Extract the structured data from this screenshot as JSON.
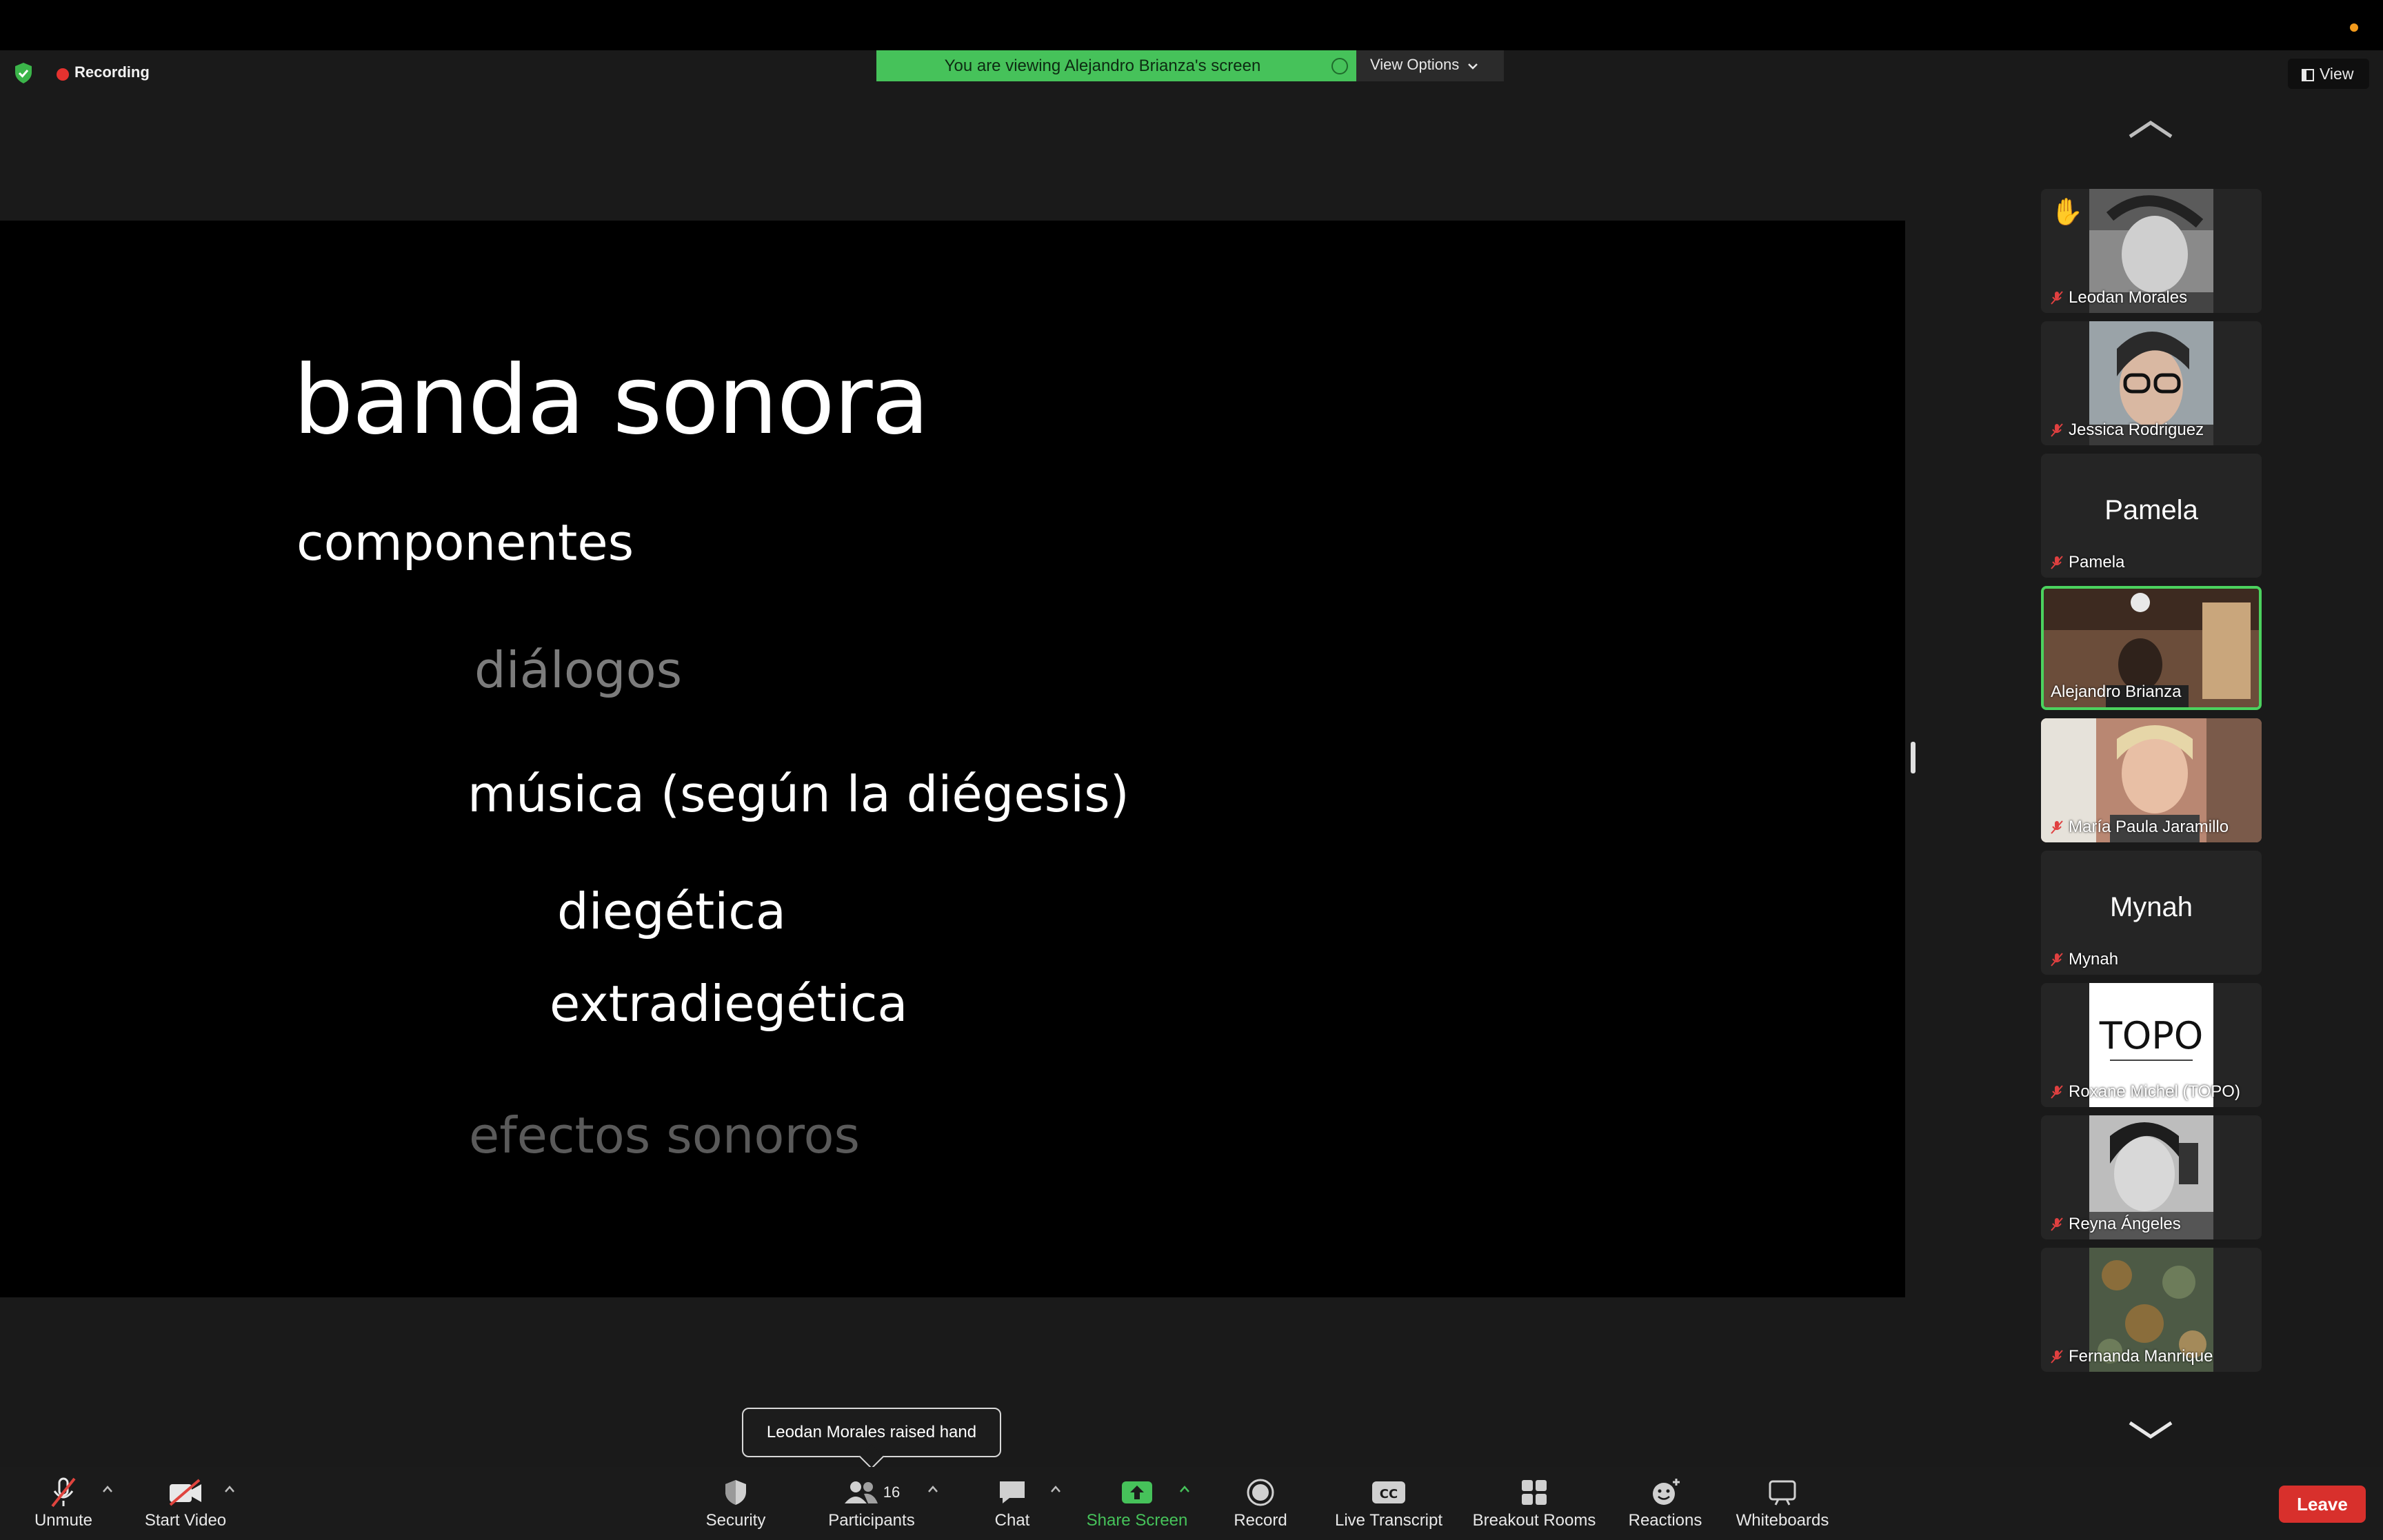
{
  "header": {
    "recording_label": "Recording",
    "viewing_banner": "You are viewing Alejandro Brianza's screen",
    "view_options_label": "View Options",
    "view_label": "View"
  },
  "slide": {
    "title": "banda sonora",
    "subtitle": "componentes",
    "item1": "diálogos",
    "item2": "música (según la diégesis)",
    "item2a": "diegética",
    "item2b": "extradiegética",
    "item3": "efectos sonoros"
  },
  "participants": [
    {
      "name": "Leodan Morales",
      "muted": true,
      "hand_raised": true,
      "video": true
    },
    {
      "name": "Jessica Rodriguez",
      "muted": true,
      "video": true
    },
    {
      "name": "Pamela",
      "muted": true,
      "video": false
    },
    {
      "name": "Alejandro Brianza",
      "muted": false,
      "video": true,
      "active_speaker": true
    },
    {
      "name": "María Paula Jaramillo",
      "muted": true,
      "video": true
    },
    {
      "name": "Mynah",
      "muted": true,
      "video": false
    },
    {
      "name": "Roxane Michel (TOPO)",
      "muted": true,
      "video": true
    },
    {
      "name": "Reyna Ángeles",
      "muted": true,
      "video": true
    },
    {
      "name": "Fernanda Manrique",
      "muted": true,
      "video": true
    }
  ],
  "toolbar": {
    "unmute": "Unmute",
    "start_video": "Start Video",
    "security": "Security",
    "participants": "Participants",
    "participants_count": "16",
    "chat": "Chat",
    "share_screen": "Share Screen",
    "record": "Record",
    "live_transcript": "Live Transcript",
    "breakout_rooms": "Breakout Rooms",
    "reactions": "Reactions",
    "whiteboards": "Whiteboards",
    "leave": "Leave"
  },
  "notification": "Leodan Morales raised hand",
  "topo_logo_text": "TOPO",
  "colors": {
    "accent_green": "#46c25a",
    "leave_red": "#d8302c",
    "recording_red": "#e5322f"
  }
}
